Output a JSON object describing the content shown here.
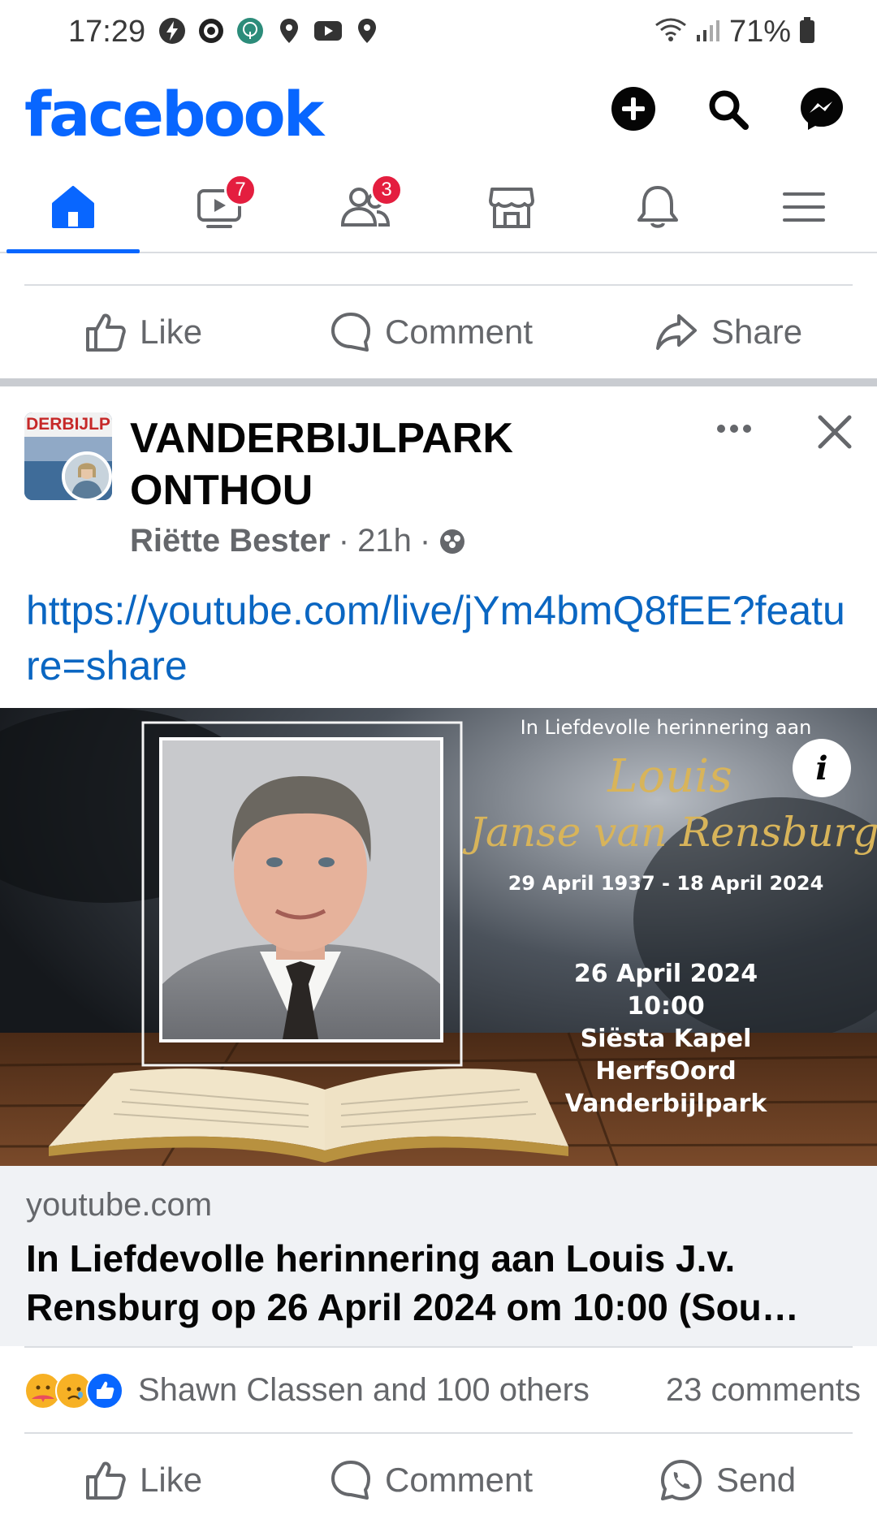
{
  "status_bar": {
    "time": "17:29",
    "battery": "71%"
  },
  "header": {
    "logo": "facebook",
    "icons": [
      "add-icon",
      "search-icon",
      "messenger-icon"
    ]
  },
  "nav": {
    "tabs": [
      {
        "name": "home",
        "icon": "home-icon",
        "active": true
      },
      {
        "name": "video",
        "icon": "video-icon",
        "badge": "7"
      },
      {
        "name": "friends",
        "icon": "friends-icon",
        "badge": "3"
      },
      {
        "name": "marketplace",
        "icon": "marketplace-icon"
      },
      {
        "name": "notifications",
        "icon": "bell-icon"
      },
      {
        "name": "menu",
        "icon": "menu-icon"
      }
    ]
  },
  "prev_post_actions": {
    "like": "Like",
    "comment": "Comment",
    "share": "Share"
  },
  "post": {
    "page_name": "VANDERBIJLPARK ONTHOU",
    "avatar_text": "DERBIJLP",
    "author": "Riëtte Bester",
    "time": "21h",
    "separator": "·",
    "link_text": "https://youtube.com/live/jYm4bmQ8fEE?feature=share",
    "image": {
      "heading": "In Liefdevolle herinnering aan",
      "first_name": "Louis",
      "surname": "Janse van Rensburg",
      "dates": "29 April 1937 - 18 April 2024",
      "service_date": "26 April 2024",
      "service_time": "10:00",
      "venue": "Siësta Kapel",
      "venue2": "HerfsOord",
      "town": "Vanderbijlpark",
      "info": "i"
    },
    "preview": {
      "domain": "youtube.com",
      "title_line1": "In Liefdevolle herinnering aan Louis J.v.",
      "title_line2": "Rensburg op 26 April 2024 om 10:00 (Sou…"
    },
    "reactions_text": "Shawn Classen and 100 others",
    "comments": "23 comments",
    "actions": {
      "like": "Like",
      "comment": "Comment",
      "send": "Send"
    }
  },
  "colors": {
    "brand": "#0866ff",
    "link": "#0a66c2",
    "secondary_text": "#65676b",
    "badge": "#e41e3f",
    "gold_script": "#d8b45a"
  }
}
